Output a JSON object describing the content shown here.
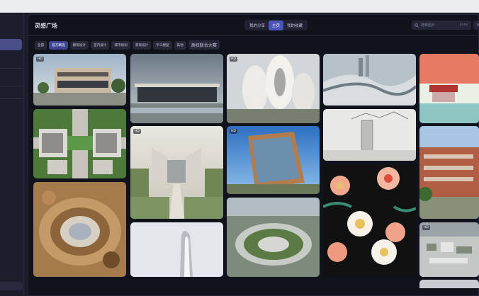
{
  "header": {
    "title": "灵感广场",
    "tabs": [
      "我的分享",
      "主页",
      "我的收藏"
    ],
    "active_tab": "主页",
    "search_placeholder": "搜索图片",
    "search_shortcut": "Enter"
  },
  "categories": [
    "全部",
    "官方精选",
    "建筑设计",
    "室内设计",
    "城市规划",
    "景观设计",
    "手工模型",
    "其他",
    "高校联合大赛"
  ],
  "active_category": "官方精选",
  "gallery": {
    "hd_badge": "HD",
    "tiles": [
      {
        "name": "modern-building-render",
        "hd": true
      },
      {
        "name": "glass-pavilion-render",
        "hd": false
      },
      {
        "name": "organic-white-towers-render",
        "hd": true
      },
      {
        "name": "flowing-city-curves-render",
        "hd": false
      },
      {
        "name": "red-pagoda-painting",
        "hd": false
      },
      {
        "name": "symmetrical-plan-render",
        "hd": false
      },
      {
        "name": "campus-gate-render",
        "hd": true
      },
      {
        "name": "timber-glass-office-render",
        "hd": true
      },
      {
        "name": "sketch-tower-drawing",
        "hd": false
      },
      {
        "name": "brick-campus-render",
        "hd": false
      },
      {
        "name": "curved-pattern-sculpture",
        "hd": false
      },
      {
        "name": "white-tower-render",
        "hd": false
      },
      {
        "name": "circular-park-aerial",
        "hd": false
      },
      {
        "name": "floral-pattern-art",
        "hd": false
      },
      {
        "name": "city-aerial-render",
        "hd": true
      }
    ]
  },
  "colors": {
    "accent": "#4b54b8",
    "background": "#11131c",
    "sidebar": "#1c1e2c"
  }
}
